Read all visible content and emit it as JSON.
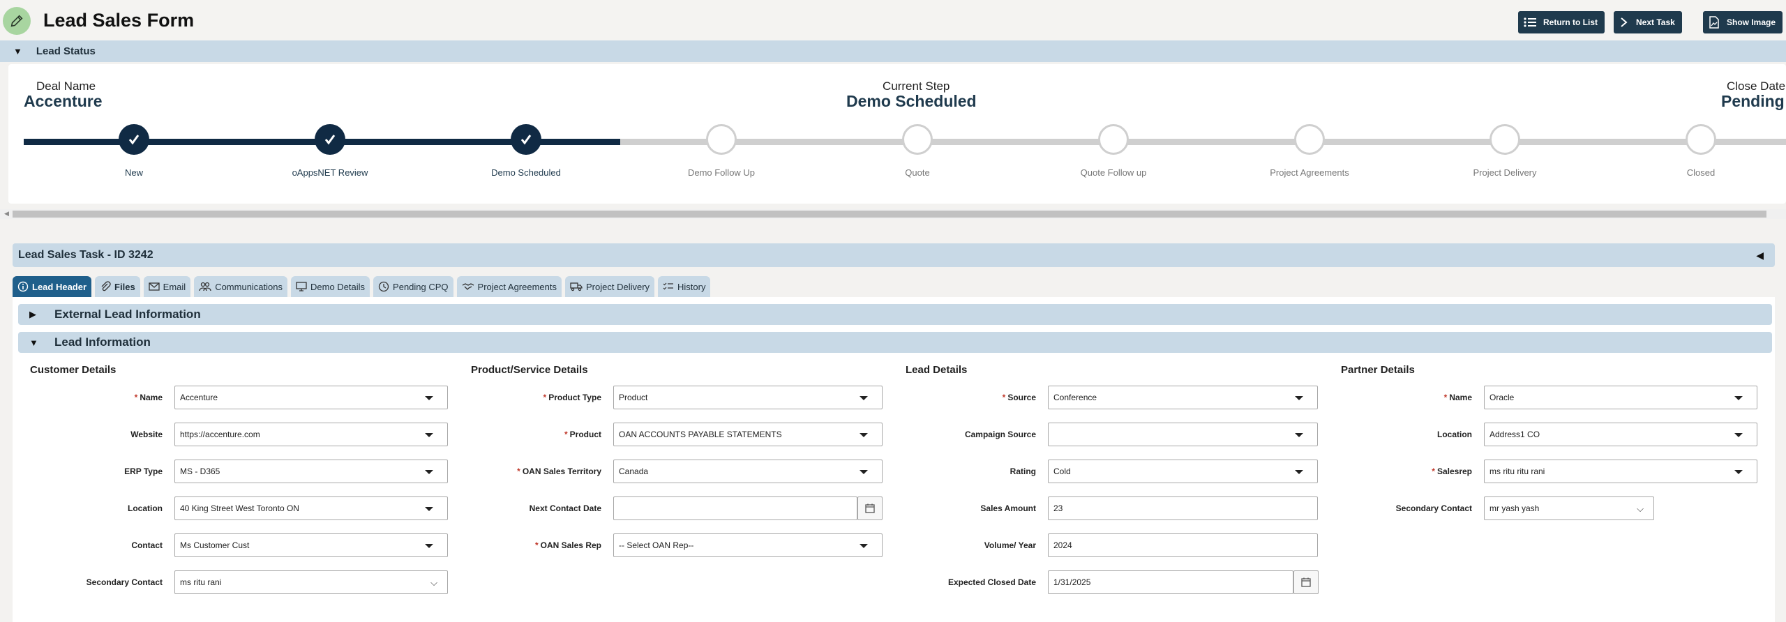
{
  "header": {
    "title": "Lead Sales Form",
    "buttons": {
      "return": "Return to List",
      "next": "Next Task",
      "show_image": "Show Image"
    }
  },
  "lead_status": {
    "section_label": "Lead Status",
    "deal_name_label": "Deal Name",
    "deal_name": "Accenture",
    "current_step_label": "Current Step",
    "current_step": "Demo Scheduled",
    "close_date_label": "Close Date",
    "close_date": "Pending",
    "steps": [
      {
        "label": "New",
        "done": true
      },
      {
        "label": "oAppsNET Review",
        "done": true
      },
      {
        "label": "Demo Scheduled",
        "done": true
      },
      {
        "label": "Demo Follow Up",
        "done": false
      },
      {
        "label": "Quote",
        "done": false
      },
      {
        "label": "Quote Follow up",
        "done": false
      },
      {
        "label": "Project Agreements",
        "done": false
      },
      {
        "label": "Project Delivery",
        "done": false
      },
      {
        "label": "Closed",
        "done": false
      }
    ]
  },
  "task": {
    "title": "Lead Sales Task - ID 3242"
  },
  "tabs": [
    {
      "label": "Lead Header",
      "icon": "info-icon",
      "active": true
    },
    {
      "label": "Files",
      "icon": "paperclip-icon",
      "active": false
    },
    {
      "label": "Email",
      "icon": "mail-icon",
      "active": false
    },
    {
      "label": "Communications",
      "icon": "people-icon",
      "active": false
    },
    {
      "label": "Demo Details",
      "icon": "monitor-icon",
      "active": false
    },
    {
      "label": "Pending CPQ",
      "icon": "clock-icon",
      "active": false
    },
    {
      "label": "Project Agreements",
      "icon": "handshake-icon",
      "active": false
    },
    {
      "label": "Project Delivery",
      "icon": "truck-icon",
      "active": false
    },
    {
      "label": "History",
      "icon": "list-check-icon",
      "active": false
    }
  ],
  "sections": {
    "external": "External Lead Information",
    "lead_info": "Lead Information"
  },
  "customer": {
    "title": "Customer Details",
    "name_label": "Name",
    "name": "Accenture",
    "website_label": "Website",
    "website": "https://accenture.com",
    "erp_label": "ERP Type",
    "erp": "MS - D365",
    "location_label": "Location",
    "location": "40 King Street West Toronto ON",
    "contact_label": "Contact",
    "contact": "Ms Customer Cust",
    "secondary_label": "Secondary Contact",
    "secondary": "ms ritu rani"
  },
  "product": {
    "title": "Product/Service Details",
    "type_label": "Product Type",
    "type": "Product",
    "product_label": "Product",
    "product": "OAN ACCOUNTS PAYABLE STATEMENTS",
    "territory_label": "OAN Sales Territory",
    "territory": "Canada",
    "next_contact_label": "Next Contact Date",
    "next_contact": "",
    "rep_label": "OAN Sales Rep",
    "rep": "-- Select OAN Rep--"
  },
  "lead": {
    "title": "Lead Details",
    "source_label": "Source",
    "source": "Conference",
    "campaign_label": "Campaign Source",
    "campaign": "",
    "rating_label": "Rating",
    "rating": "Cold",
    "amount_label": "Sales Amount",
    "amount": "23",
    "volume_label": "Volume/ Year",
    "volume": "2024",
    "closed_label": "Expected Closed Date",
    "closed": "1/31/2025"
  },
  "partner": {
    "title": "Partner Details",
    "name_label": "Name",
    "name": "Oracle",
    "location_label": "Location",
    "location": "Address1 CO",
    "salesrep_label": "Salesrep",
    "salesrep": "ms ritu ritu rani",
    "secondary_label": "Secondary Contact",
    "secondary": "mr yash yash"
  }
}
